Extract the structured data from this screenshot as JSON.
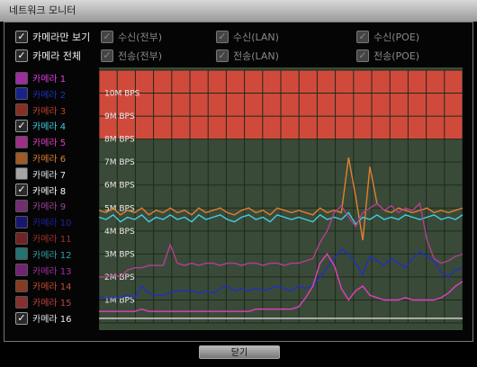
{
  "window": {
    "title": "네트워크 모니터"
  },
  "top_options": {
    "camera_only": "카메라만 보기",
    "camera_all": "카메라 전체",
    "recv_all": "수신(전부)",
    "recv_lan": "수신(LAN)",
    "recv_poe": "수신(POE)",
    "send_all": "전송(전부)",
    "send_lan": "전송(LAN)",
    "send_poe": "전송(POE)"
  },
  "cameras": [
    {
      "label": "카메라 1",
      "color": "#e040e0",
      "checked": false
    },
    {
      "label": "카메라 2",
      "color": "#2030c0",
      "checked": false
    },
    {
      "label": "카메라 3",
      "color": "#c04030",
      "checked": false
    },
    {
      "label": "카메라 4",
      "color": "#40d0e0",
      "checked": true
    },
    {
      "label": "카메라 5",
      "color": "#e040c0",
      "checked": false
    },
    {
      "label": "카메라 6",
      "color": "#e08030",
      "checked": false
    },
    {
      "label": "카메라 7",
      "color": "#e8e8e8",
      "checked": false
    },
    {
      "label": "카메라 8",
      "color": "#ffffff",
      "checked": true
    },
    {
      "label": "카메라 9",
      "color": "#a040a0",
      "checked": false
    },
    {
      "label": "카메라 10",
      "color": "#2020a0",
      "checked": false
    },
    {
      "label": "카메라 11",
      "color": "#a03030",
      "checked": false
    },
    {
      "label": "카메라 12",
      "color": "#30a0a0",
      "checked": false
    },
    {
      "label": "카메라 13",
      "color": "#a030a0",
      "checked": false
    },
    {
      "label": "카메라 14",
      "color": "#c05030",
      "checked": false
    },
    {
      "label": "카메라 15",
      "color": "#c04040",
      "checked": false
    },
    {
      "label": "카메라 16",
      "color": "#e8e8e8",
      "checked": true
    }
  ],
  "chart_data": {
    "type": "line",
    "y_ticks": [
      "10M BPS",
      "9M BPS",
      "8M BPS",
      "7M BPS",
      "6M BPS",
      "5M BPS",
      "4M BPS",
      "3M BPS",
      "2M BPS",
      "1M BPS"
    ],
    "ylim": [
      0,
      11
    ],
    "over_limit_from": 8,
    "grid": true,
    "series": [
      {
        "color": "#e08030",
        "values": [
          4.9,
          4.8,
          5.0,
          4.7,
          4.9,
          4.8,
          5.0,
          4.7,
          4.9,
          4.8,
          5.0,
          4.8,
          4.9,
          4.7,
          5.0,
          4.8,
          4.9,
          5.0,
          4.8,
          4.7,
          4.9,
          5.0,
          4.8,
          4.9,
          4.7,
          5.0,
          4.9,
          4.8,
          4.9,
          4.8,
          4.7,
          5.0,
          4.8,
          4.9,
          4.8,
          7.2,
          5.5,
          3.6,
          6.8,
          5.2,
          4.9,
          4.8,
          5.0,
          4.9,
          4.8,
          4.9,
          5.0,
          4.8,
          4.9,
          4.8,
          4.9,
          5.0
        ]
      },
      {
        "color": "#40d0e0",
        "values": [
          4.6,
          4.5,
          4.7,
          4.4,
          4.6,
          4.5,
          4.7,
          4.4,
          4.6,
          4.5,
          4.7,
          4.5,
          4.6,
          4.4,
          4.7,
          4.5,
          4.6,
          4.7,
          4.5,
          4.4,
          4.6,
          4.7,
          4.5,
          4.6,
          4.4,
          4.7,
          4.6,
          4.5,
          4.6,
          4.5,
          4.4,
          4.7,
          4.5,
          4.6,
          4.5,
          4.8,
          4.3,
          4.6,
          4.5,
          4.7,
          4.5,
          4.6,
          4.5,
          4.7,
          4.6,
          4.5,
          4.6,
          4.7,
          4.5,
          4.6,
          4.5,
          4.7
        ]
      },
      {
        "color": "#b04090",
        "values": [
          2.0,
          2.0,
          2.1,
          2.0,
          2.3,
          2.4,
          2.4,
          2.5,
          2.5,
          2.5,
          3.4,
          2.6,
          2.5,
          2.6,
          2.5,
          2.6,
          2.6,
          2.5,
          2.6,
          2.6,
          2.5,
          2.6,
          2.6,
          2.5,
          2.6,
          2.6,
          2.5,
          2.6,
          2.6,
          2.7,
          2.8,
          3.5,
          4.0,
          4.8,
          5.1,
          4.6,
          4.2,
          4.8,
          5.0,
          5.2,
          4.9,
          5.1,
          4.8,
          5.0,
          4.9,
          5.2,
          3.6,
          2.8,
          2.6,
          2.7,
          2.9,
          3.0
        ]
      },
      {
        "color": "#2030c0",
        "values": [
          1.1,
          1.1,
          1.1,
          1.1,
          1.2,
          1.1,
          1.6,
          1.3,
          1.2,
          1.2,
          1.3,
          1.4,
          1.4,
          1.4,
          1.3,
          1.4,
          1.3,
          1.5,
          1.6,
          1.4,
          1.5,
          1.4,
          1.5,
          1.4,
          1.5,
          1.6,
          1.5,
          1.4,
          1.6,
          1.5,
          1.6,
          2.0,
          2.4,
          2.8,
          3.2,
          3.0,
          2.6,
          2.1,
          2.9,
          2.7,
          2.5,
          2.8,
          2.6,
          2.4,
          2.8,
          3.1,
          2.9,
          2.7,
          2.2,
          2.0,
          2.3,
          2.4
        ]
      },
      {
        "color": "#e040c0",
        "values": [
          0.5,
          0.5,
          0.5,
          0.5,
          0.5,
          0.5,
          0.6,
          0.5,
          0.5,
          0.5,
          0.5,
          0.5,
          0.5,
          0.5,
          0.5,
          0.5,
          0.5,
          0.5,
          0.5,
          0.5,
          0.5,
          0.5,
          0.6,
          0.6,
          0.6,
          0.6,
          0.6,
          0.6,
          0.7,
          1.1,
          1.6,
          2.6,
          3.0,
          2.5,
          1.5,
          1.0,
          1.4,
          1.6,
          1.2,
          1.1,
          1.0,
          1.0,
          1.0,
          1.1,
          1.0,
          1.0,
          1.0,
          1.0,
          1.1,
          1.3,
          1.6,
          1.8
        ]
      },
      {
        "color": "#d8d8d8",
        "values": [
          0.2,
          0.2,
          0.2,
          0.2,
          0.2,
          0.2,
          0.2,
          0.2,
          0.2,
          0.2,
          0.2,
          0.2,
          0.2,
          0.2,
          0.2,
          0.2,
          0.2,
          0.2,
          0.2,
          0.2,
          0.2,
          0.2,
          0.2,
          0.2,
          0.2,
          0.2,
          0.2,
          0.2,
          0.2,
          0.2,
          0.2,
          0.2,
          0.2,
          0.2,
          0.2,
          0.2,
          0.2,
          0.2,
          0.2,
          0.2,
          0.2,
          0.2,
          0.2,
          0.2,
          0.2,
          0.2,
          0.2,
          0.2,
          0.2,
          0.2,
          0.2,
          0.2
        ]
      }
    ]
  },
  "footer": {
    "close_label": "닫기"
  }
}
